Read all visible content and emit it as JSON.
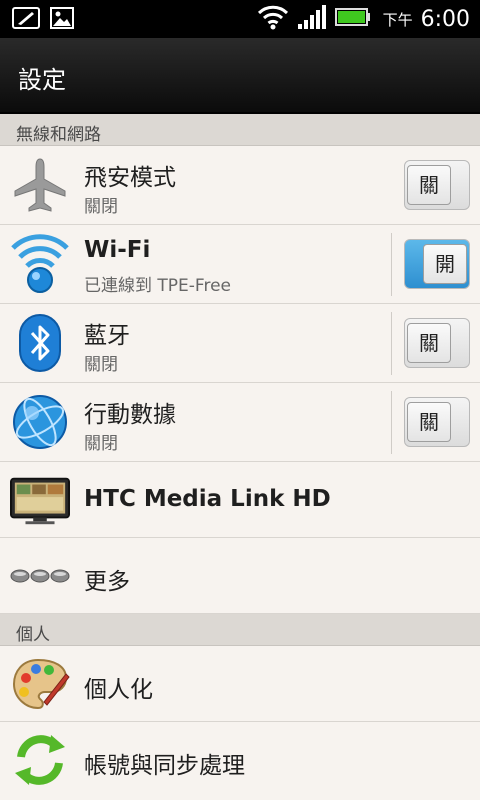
{
  "status_bar": {
    "ampm": "下午",
    "time": "6:00"
  },
  "header": {
    "title": "設定"
  },
  "sections": [
    {
      "header": "無線和網路",
      "items": [
        {
          "title": "飛安模式",
          "subtitle": "關閉",
          "toggle": "關"
        },
        {
          "title": "Wi-Fi",
          "subtitle": "已連線到 TPE-Free",
          "toggle": "開"
        },
        {
          "title": "藍牙",
          "subtitle": "關閉",
          "toggle": "關"
        },
        {
          "title": "行動數據",
          "subtitle": "關閉",
          "toggle": "關"
        },
        {
          "title": "HTC Media Link HD"
        },
        {
          "title": "更多"
        }
      ]
    },
    {
      "header": "個人",
      "items": [
        {
          "title": "個人化"
        },
        {
          "title": "帳號與同步處理"
        }
      ]
    }
  ]
}
